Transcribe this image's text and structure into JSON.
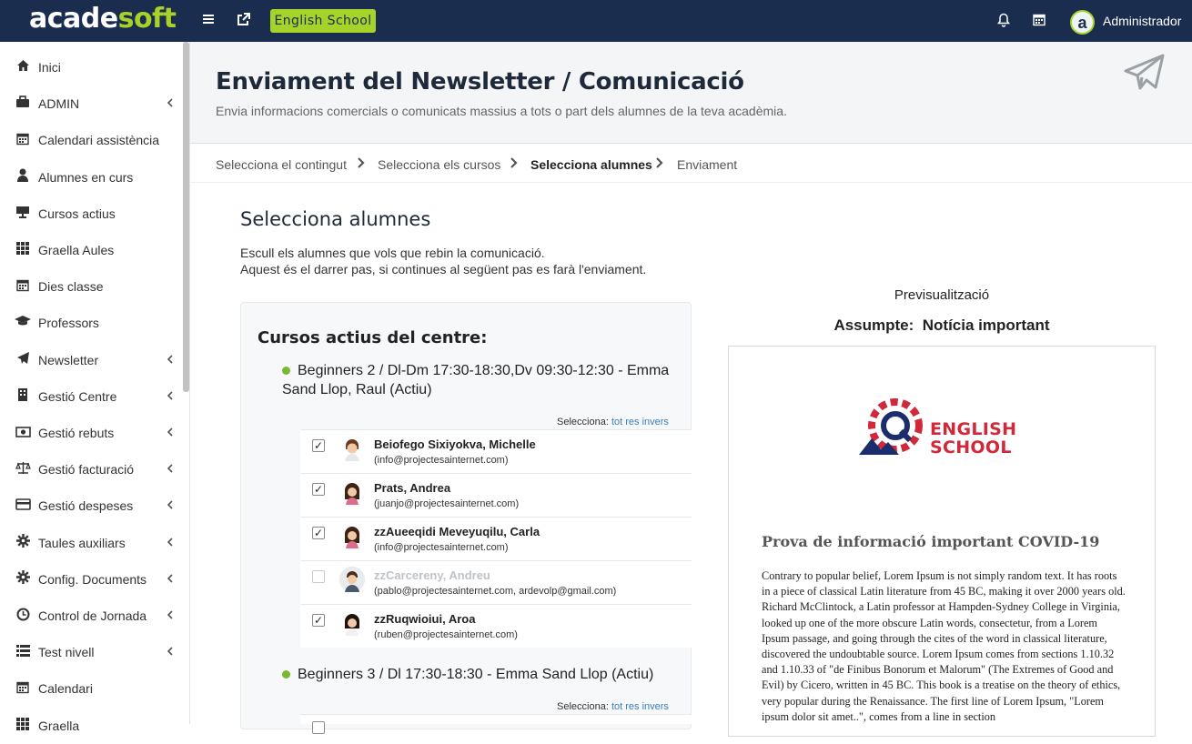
{
  "topbar": {
    "logo_part1": "acade",
    "logo_part2": "soft",
    "school_label": "English School",
    "avatar_letter": "a",
    "user_name": "Administrador"
  },
  "sidebar": {
    "items": [
      {
        "label": "Inici",
        "icon": "home-icon",
        "has_sub": false
      },
      {
        "label": "ADMIN",
        "icon": "briefcase-icon",
        "has_sub": true
      },
      {
        "label": "Calendari assistència",
        "icon": "calendar-icon",
        "has_sub": false
      },
      {
        "label": "Alumnes en curs",
        "icon": "user-icon",
        "has_sub": false
      },
      {
        "label": "Cursos actius",
        "icon": "presentation-icon",
        "has_sub": false
      },
      {
        "label": "Graella Aules",
        "icon": "grid-icon",
        "has_sub": false
      },
      {
        "label": "Dies classe",
        "icon": "calendar-icon",
        "has_sub": false
      },
      {
        "label": "Professors",
        "icon": "graduation-cap-icon",
        "has_sub": false
      },
      {
        "label": "Newsletter",
        "icon": "paper-plane-icon",
        "has_sub": true
      },
      {
        "label": "Gestió Centre",
        "icon": "building-icon",
        "has_sub": true
      },
      {
        "label": "Gestió rebuts",
        "icon": "money-icon",
        "has_sub": true
      },
      {
        "label": "Gestió facturació",
        "icon": "balance-scale-icon",
        "has_sub": true
      },
      {
        "label": "Gestió despeses",
        "icon": "credit-card-icon",
        "has_sub": true
      },
      {
        "label": "Taules auxiliars",
        "icon": "gear-icon",
        "has_sub": true
      },
      {
        "label": "Config. Documents",
        "icon": "gear-icon",
        "has_sub": true
      },
      {
        "label": "Control de Jornada",
        "icon": "clock-icon",
        "has_sub": true
      },
      {
        "label": "Test nivell",
        "icon": "list-icon",
        "has_sub": true
      },
      {
        "label": "Calendari",
        "icon": "calendar-icon",
        "has_sub": false
      },
      {
        "label": "Graella",
        "icon": "grid-icon",
        "has_sub": false
      }
    ]
  },
  "header": {
    "title": "Enviament del Newsletter / Comunicació",
    "subtitle": "Envia informacions comercials o comunicats massius a tots o part dels alumnes de la teva acadèmia."
  },
  "steps": [
    {
      "label": "Selecciona el contingut",
      "active": false
    },
    {
      "label": "Selecciona els cursos",
      "active": false
    },
    {
      "label": "Selecciona alumnes",
      "active": true
    },
    {
      "label": "Enviament",
      "active": false
    }
  ],
  "main": {
    "title": "Selecciona alumnes",
    "desc_line1": "Escull els alumnes que vols que rebin la comunicació.",
    "desc_line2": "Aquest és el darrer pas, si continues al següent pas es farà l'enviament."
  },
  "panel": {
    "title": "Cursos actius del centre:",
    "select_prefix": "Selecciona:",
    "select_all": "tot",
    "select_none": "res",
    "select_invert": "invers",
    "courses": [
      {
        "name": "Beginners 2 / Dl-Dm 17:30-18:30,Dv 09:30-12:30 - Emma Sand Llop, Raul (Actiu)",
        "students": [
          {
            "name": "Beiofego Sixiyokva, Michelle",
            "email": "(info@projectesainternet.com)",
            "checked": true,
            "enabled": true
          },
          {
            "name": "Prats, Andrea",
            "email": "(juanjo@projectesainternet.com)",
            "checked": true,
            "enabled": true
          },
          {
            "name": "zzAueeqidi Meveyuqilu, Carla",
            "email": "(info@projectesainternet.com)",
            "checked": true,
            "enabled": true
          },
          {
            "name": "zzCarcereny, Andreu",
            "email": "(pablo@projectesainternet.com, ardevolp@gmail.com)",
            "checked": false,
            "enabled": false
          },
          {
            "name": "zzRuqwioiui, Aroa",
            "email": "(ruben@projectesainternet.com)",
            "checked": true,
            "enabled": true
          }
        ]
      },
      {
        "name": "Beginners 3 / Dl 17:30-18:30 - Emma Sand Llop (Actiu)",
        "students": []
      }
    ]
  },
  "preview": {
    "label": "Previsualització",
    "subject_prefix": "Assumpte:",
    "subject": "Notícia important",
    "logo_line1": "ENGLISH",
    "logo_line2": "SCHOOL",
    "news_title": "Prova de informació important COVID-19",
    "news_body": "Contrary to popular belief, Lorem Ipsum is not simply random text. It has roots in a piece of classical Latin literature from 45 BC, making it over 2000 years old. Richard McClintock, a Latin professor at Hampden-Sydney College in Virginia, looked up one of the more obscure Latin words, consectetur, from a Lorem Ipsum passage, and going through the cites of the word in classical literature, discovered the undoubtable source. Lorem Ipsum comes from sections 1.10.32 and 1.10.33 of \"de Finibus Bonorum et Malorum\" (The Extremes of Good and Evil) by Cicero, written in 45 BC. This book is a treatise on the theory of ethics, very popular during the Renaissance. The first line of Lorem Ipsum, \"Lorem ipsum dolor sit amet..\", comes from a line in section"
  },
  "colors": {
    "topbar": "#1b2d4f",
    "accent": "#a6d32a",
    "active_dot": "#7bb82d",
    "link": "#3b7fb6",
    "logo_red": "#d1283a"
  }
}
